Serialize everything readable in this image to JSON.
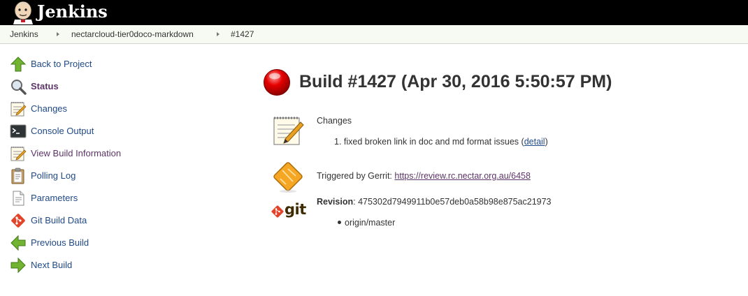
{
  "header": {
    "app_name": "Jenkins"
  },
  "breadcrumb": [
    {
      "label": "Jenkins"
    },
    {
      "label": "nectarcloud-tier0doco-markdown"
    },
    {
      "label": "#1427"
    }
  ],
  "sidebar": {
    "items": [
      {
        "label": "Back to Project",
        "icon": "up-arrow-icon"
      },
      {
        "label": "Status",
        "icon": "magnifier-icon"
      },
      {
        "label": "Changes",
        "icon": "notepad-icon"
      },
      {
        "label": "Console Output",
        "icon": "terminal-icon"
      },
      {
        "label": "View Build Information",
        "icon": "notepad-icon"
      },
      {
        "label": "Polling Log",
        "icon": "clipboard-icon"
      },
      {
        "label": "Parameters",
        "icon": "document-icon"
      },
      {
        "label": "Git Build Data",
        "icon": "git-icon"
      },
      {
        "label": "Previous Build",
        "icon": "left-arrow-icon"
      },
      {
        "label": "Next Build",
        "icon": "right-arrow-icon"
      }
    ]
  },
  "build": {
    "title": "Build #1427 (Apr 30, 2016 5:50:57 PM)",
    "status_color": "#d00000"
  },
  "changes": {
    "heading": "Changes",
    "items": [
      {
        "number": "1.",
        "text": "fixed broken link in doc and md format issues (",
        "link": "detail",
        "suffix": ")"
      }
    ]
  },
  "trigger": {
    "prefix": "Triggered by Gerrit: ",
    "url": "https://review.rc.nectar.org.au/6458"
  },
  "revision": {
    "label": "Revision",
    "separator": ": ",
    "hash": "475302d7949911b0e57deb0a58b98e875ac21973",
    "branches": [
      "origin/master"
    ],
    "git_icon_text": "git"
  }
}
